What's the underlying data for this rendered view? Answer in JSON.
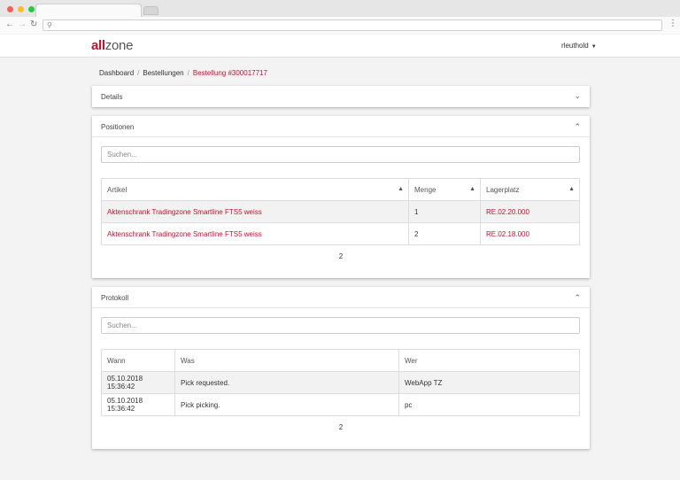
{
  "browser": {
    "tab_title": "",
    "url": ""
  },
  "header": {
    "logo_a": "all",
    "logo_b": "zone",
    "user": "rleuthold"
  },
  "breadcrumb": {
    "items": [
      "Dashboard",
      "Bestellungen"
    ],
    "active": "Bestellung #300017717"
  },
  "details": {
    "title": "Details"
  },
  "positionen": {
    "title": "Positionen",
    "search_placeholder": "Suchen...",
    "columns": [
      "Artikel",
      "Menge",
      "Lagerplatz"
    ],
    "rows": [
      {
        "artikel": "Aktenschrank Tradingzone Smartline FTS5 weiss",
        "menge": "1",
        "lagerplatz": "RE.02.20.000"
      },
      {
        "artikel": "Aktenschrank Tradingzone Smartline FTS5 weiss",
        "menge": "2",
        "lagerplatz": "RE.02.18.000"
      }
    ],
    "pager": "2"
  },
  "protokoll": {
    "title": "Protokoll",
    "search_placeholder": "Suchen...",
    "columns": [
      "Wann",
      "Was",
      "Wer"
    ],
    "rows": [
      {
        "wann": "05.10.2018 15:36:42",
        "was": "Pick requested.",
        "wer": "WebApp TZ"
      },
      {
        "wann": "05.10.2018 15:36:42",
        "was": "Pick picking.",
        "wer": "pc"
      }
    ],
    "pager": "2"
  },
  "colors": {
    "accent": "#c8102e"
  }
}
